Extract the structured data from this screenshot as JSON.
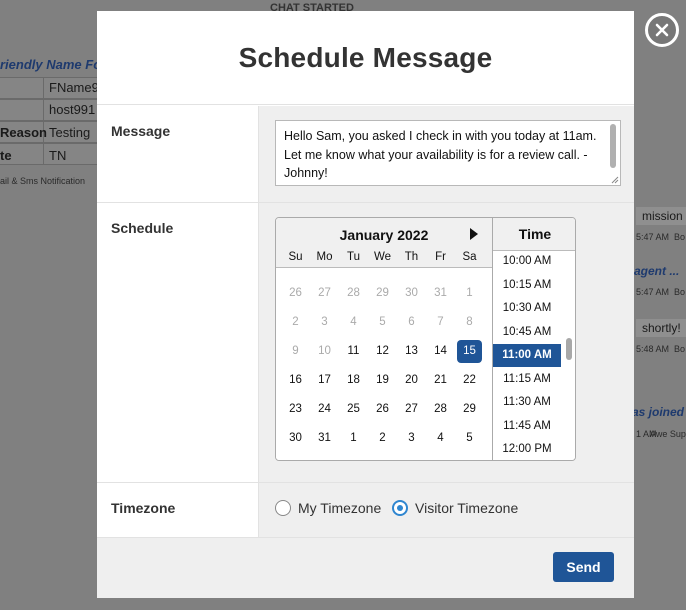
{
  "background": {
    "chat_started": "CHAT STARTED",
    "friendly_name_heading": "riendly Name For",
    "rows": [
      {
        "label": "",
        "value": "FName9"
      },
      {
        "label": "",
        "value": "host991"
      },
      {
        "label": "Reason",
        "value": "Testing"
      },
      {
        "label": "te",
        "value": "TN"
      }
    ],
    "notification_note": "ail & Sms Notification",
    "right_messages": [
      {
        "text": "mission",
        "time": "5:47 AM",
        "sender": "Bo"
      },
      {
        "text": "agent ...",
        "time": "5:47 AM",
        "sender": "Bo"
      },
      {
        "text": "shortly!",
        "time": "5:48 AM",
        "sender": "Bo"
      },
      {
        "text": "as joined",
        "time": "1 AM",
        "sender": "Awe Supp"
      }
    ]
  },
  "modal": {
    "title": "Schedule Message",
    "message_label": "Message",
    "message_text": "Hello Sam, you asked I check in with you today at 11am. Let me know what your availability is for a review call. - Johnny!",
    "schedule_label": "Schedule",
    "calendar": {
      "month": "January 2022",
      "weekdays": [
        "Su",
        "Mo",
        "Tu",
        "We",
        "Th",
        "Fr",
        "Sa"
      ],
      "weeks": [
        [
          {
            "d": "26",
            "m": true
          },
          {
            "d": "27",
            "m": true
          },
          {
            "d": "28",
            "m": true
          },
          {
            "d": "29",
            "m": true
          },
          {
            "d": "30",
            "m": true
          },
          {
            "d": "31",
            "m": true
          },
          {
            "d": "1",
            "m": true
          }
        ],
        [
          {
            "d": "2",
            "m": true
          },
          {
            "d": "3",
            "m": true
          },
          {
            "d": "4",
            "m": true
          },
          {
            "d": "5",
            "m": true
          },
          {
            "d": "6",
            "m": true
          },
          {
            "d": "7",
            "m": true
          },
          {
            "d": "8",
            "m": true
          }
        ],
        [
          {
            "d": "9",
            "m": true
          },
          {
            "d": "10",
            "m": true
          },
          {
            "d": "11"
          },
          {
            "d": "12"
          },
          {
            "d": "13"
          },
          {
            "d": "14"
          },
          {
            "d": "15",
            "s": true
          }
        ],
        [
          {
            "d": "16"
          },
          {
            "d": "17"
          },
          {
            "d": "18"
          },
          {
            "d": "19"
          },
          {
            "d": "20"
          },
          {
            "d": "21"
          },
          {
            "d": "22"
          }
        ],
        [
          {
            "d": "23"
          },
          {
            "d": "24"
          },
          {
            "d": "25"
          },
          {
            "d": "26"
          },
          {
            "d": "27"
          },
          {
            "d": "28"
          },
          {
            "d": "29"
          }
        ],
        [
          {
            "d": "30"
          },
          {
            "d": "31"
          },
          {
            "d": "1"
          },
          {
            "d": "2"
          },
          {
            "d": "3"
          },
          {
            "d": "4"
          },
          {
            "d": "5"
          }
        ]
      ]
    },
    "time": {
      "heading": "Time",
      "options": [
        "10:00 AM",
        "10:15 AM",
        "10:30 AM",
        "10:45 AM",
        "11:00 AM",
        "11:15 AM",
        "11:30 AM",
        "11:45 AM",
        "12:00 PM"
      ],
      "selected": "11:00 AM"
    },
    "timezone_label": "Timezone",
    "timezone_options": [
      {
        "label": "My Timezone",
        "checked": false
      },
      {
        "label": "Visitor Timezone",
        "checked": true
      }
    ],
    "send_label": "Send"
  },
  "colors": {
    "accent": "#1f5597",
    "radio": "#2f86d0",
    "overlay": "#808080"
  },
  "icons": {
    "close": "close-icon",
    "next_month": "caret-right-icon"
  }
}
